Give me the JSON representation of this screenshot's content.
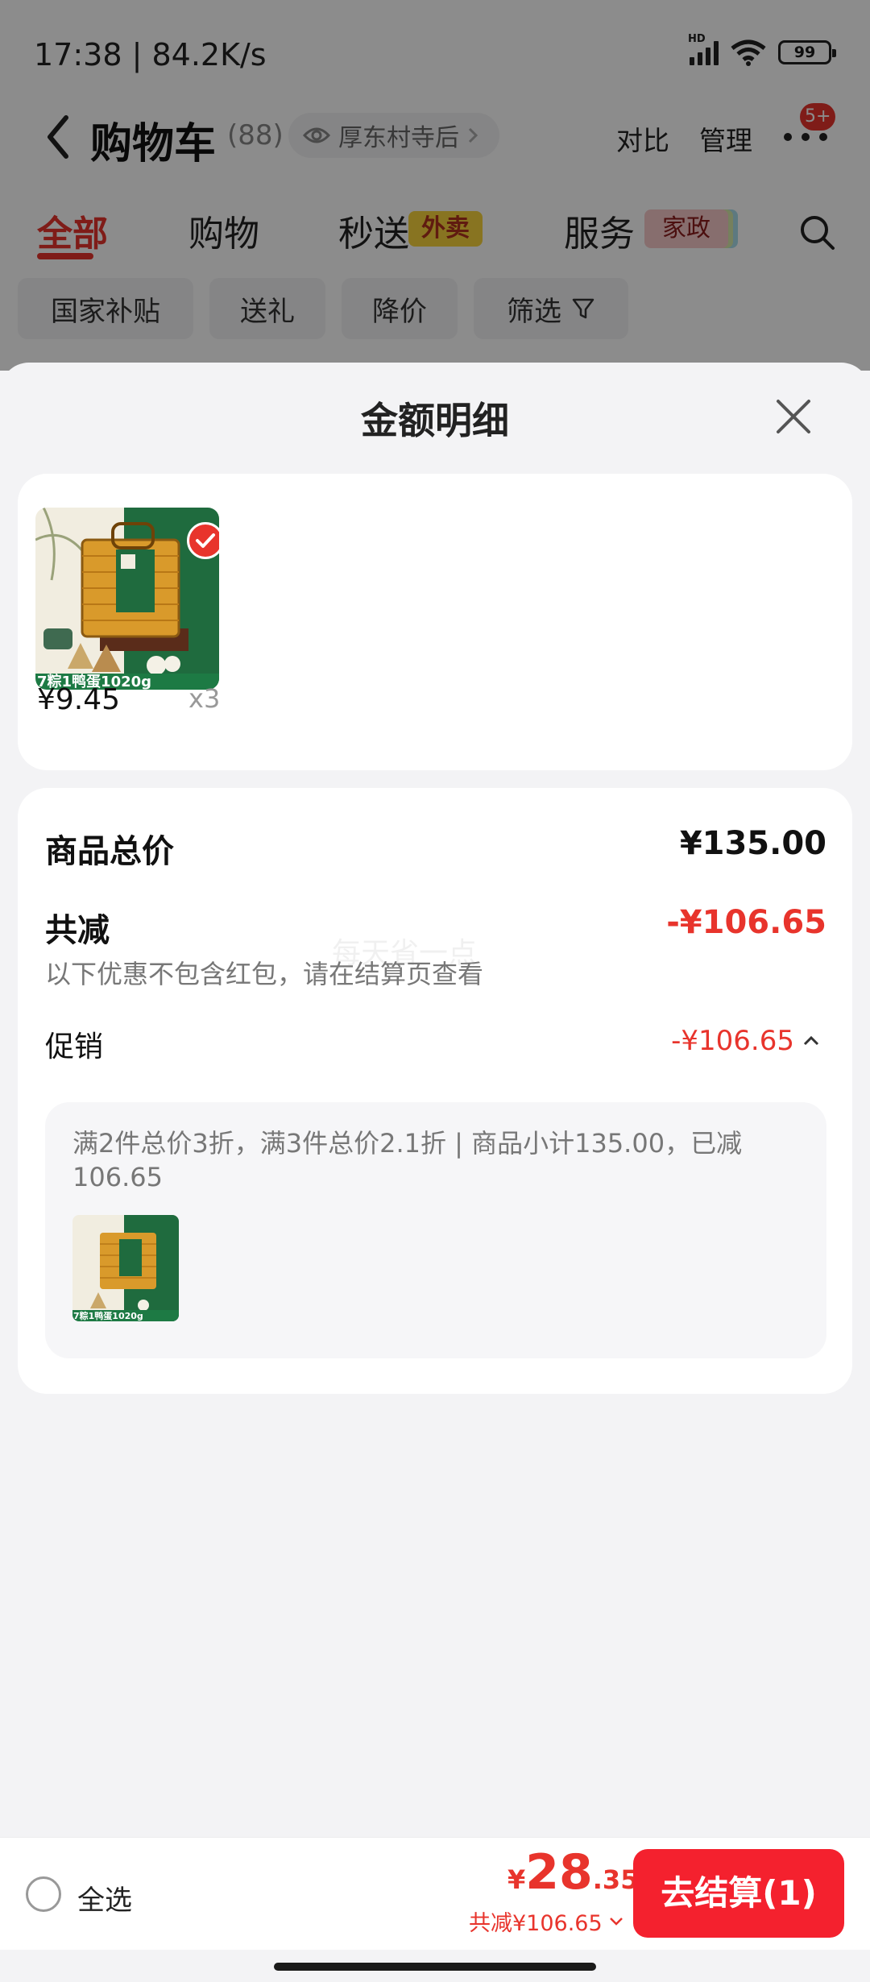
{
  "status_bar": {
    "time": "17:38 | 84.2K/s",
    "hd": "HD",
    "battery": "99"
  },
  "nav": {
    "title": "购物车",
    "count": "(88)",
    "location": "厚东村寺后",
    "compare": "对比",
    "manage": "管理",
    "badge": "5+"
  },
  "tabs": [
    {
      "label": "全部",
      "active": true
    },
    {
      "label": "购物"
    },
    {
      "label": "秒送",
      "tag": "外卖"
    },
    {
      "label": "服务",
      "tag": "家政"
    }
  ],
  "chips": [
    "国家补贴",
    "送礼",
    "降价",
    "筛选"
  ],
  "sheet": {
    "title": "金额明细",
    "item": {
      "banner": "7粽1鸭蛋1020g",
      "price": "¥9.45",
      "qty": "x3"
    },
    "total_label": "商品总价",
    "total_value": "¥135.00",
    "discount_label": "共减",
    "discount_value": "-¥106.65",
    "note": "以下优惠不包含红包，请在结算页查看",
    "watermark": "每天省一点",
    "promo_label": "促销",
    "promo_value": "-¥106.65",
    "promo_desc": "满2件总价3折，满3件总价2.1折 | 商品小计135.00，已减106.65",
    "promo_thumb_banner": "7粽1鸭蛋1020g"
  },
  "bottom": {
    "select_all": "全选",
    "yen": "¥",
    "total_int": "28",
    "total_dec": ".35",
    "total_discount": "共减¥106.65",
    "checkout": "去结算(1)"
  },
  "colors": {
    "accent": "#e8342c",
    "checkout": "#f4212e",
    "waimai_tag": "#f7d33c"
  }
}
